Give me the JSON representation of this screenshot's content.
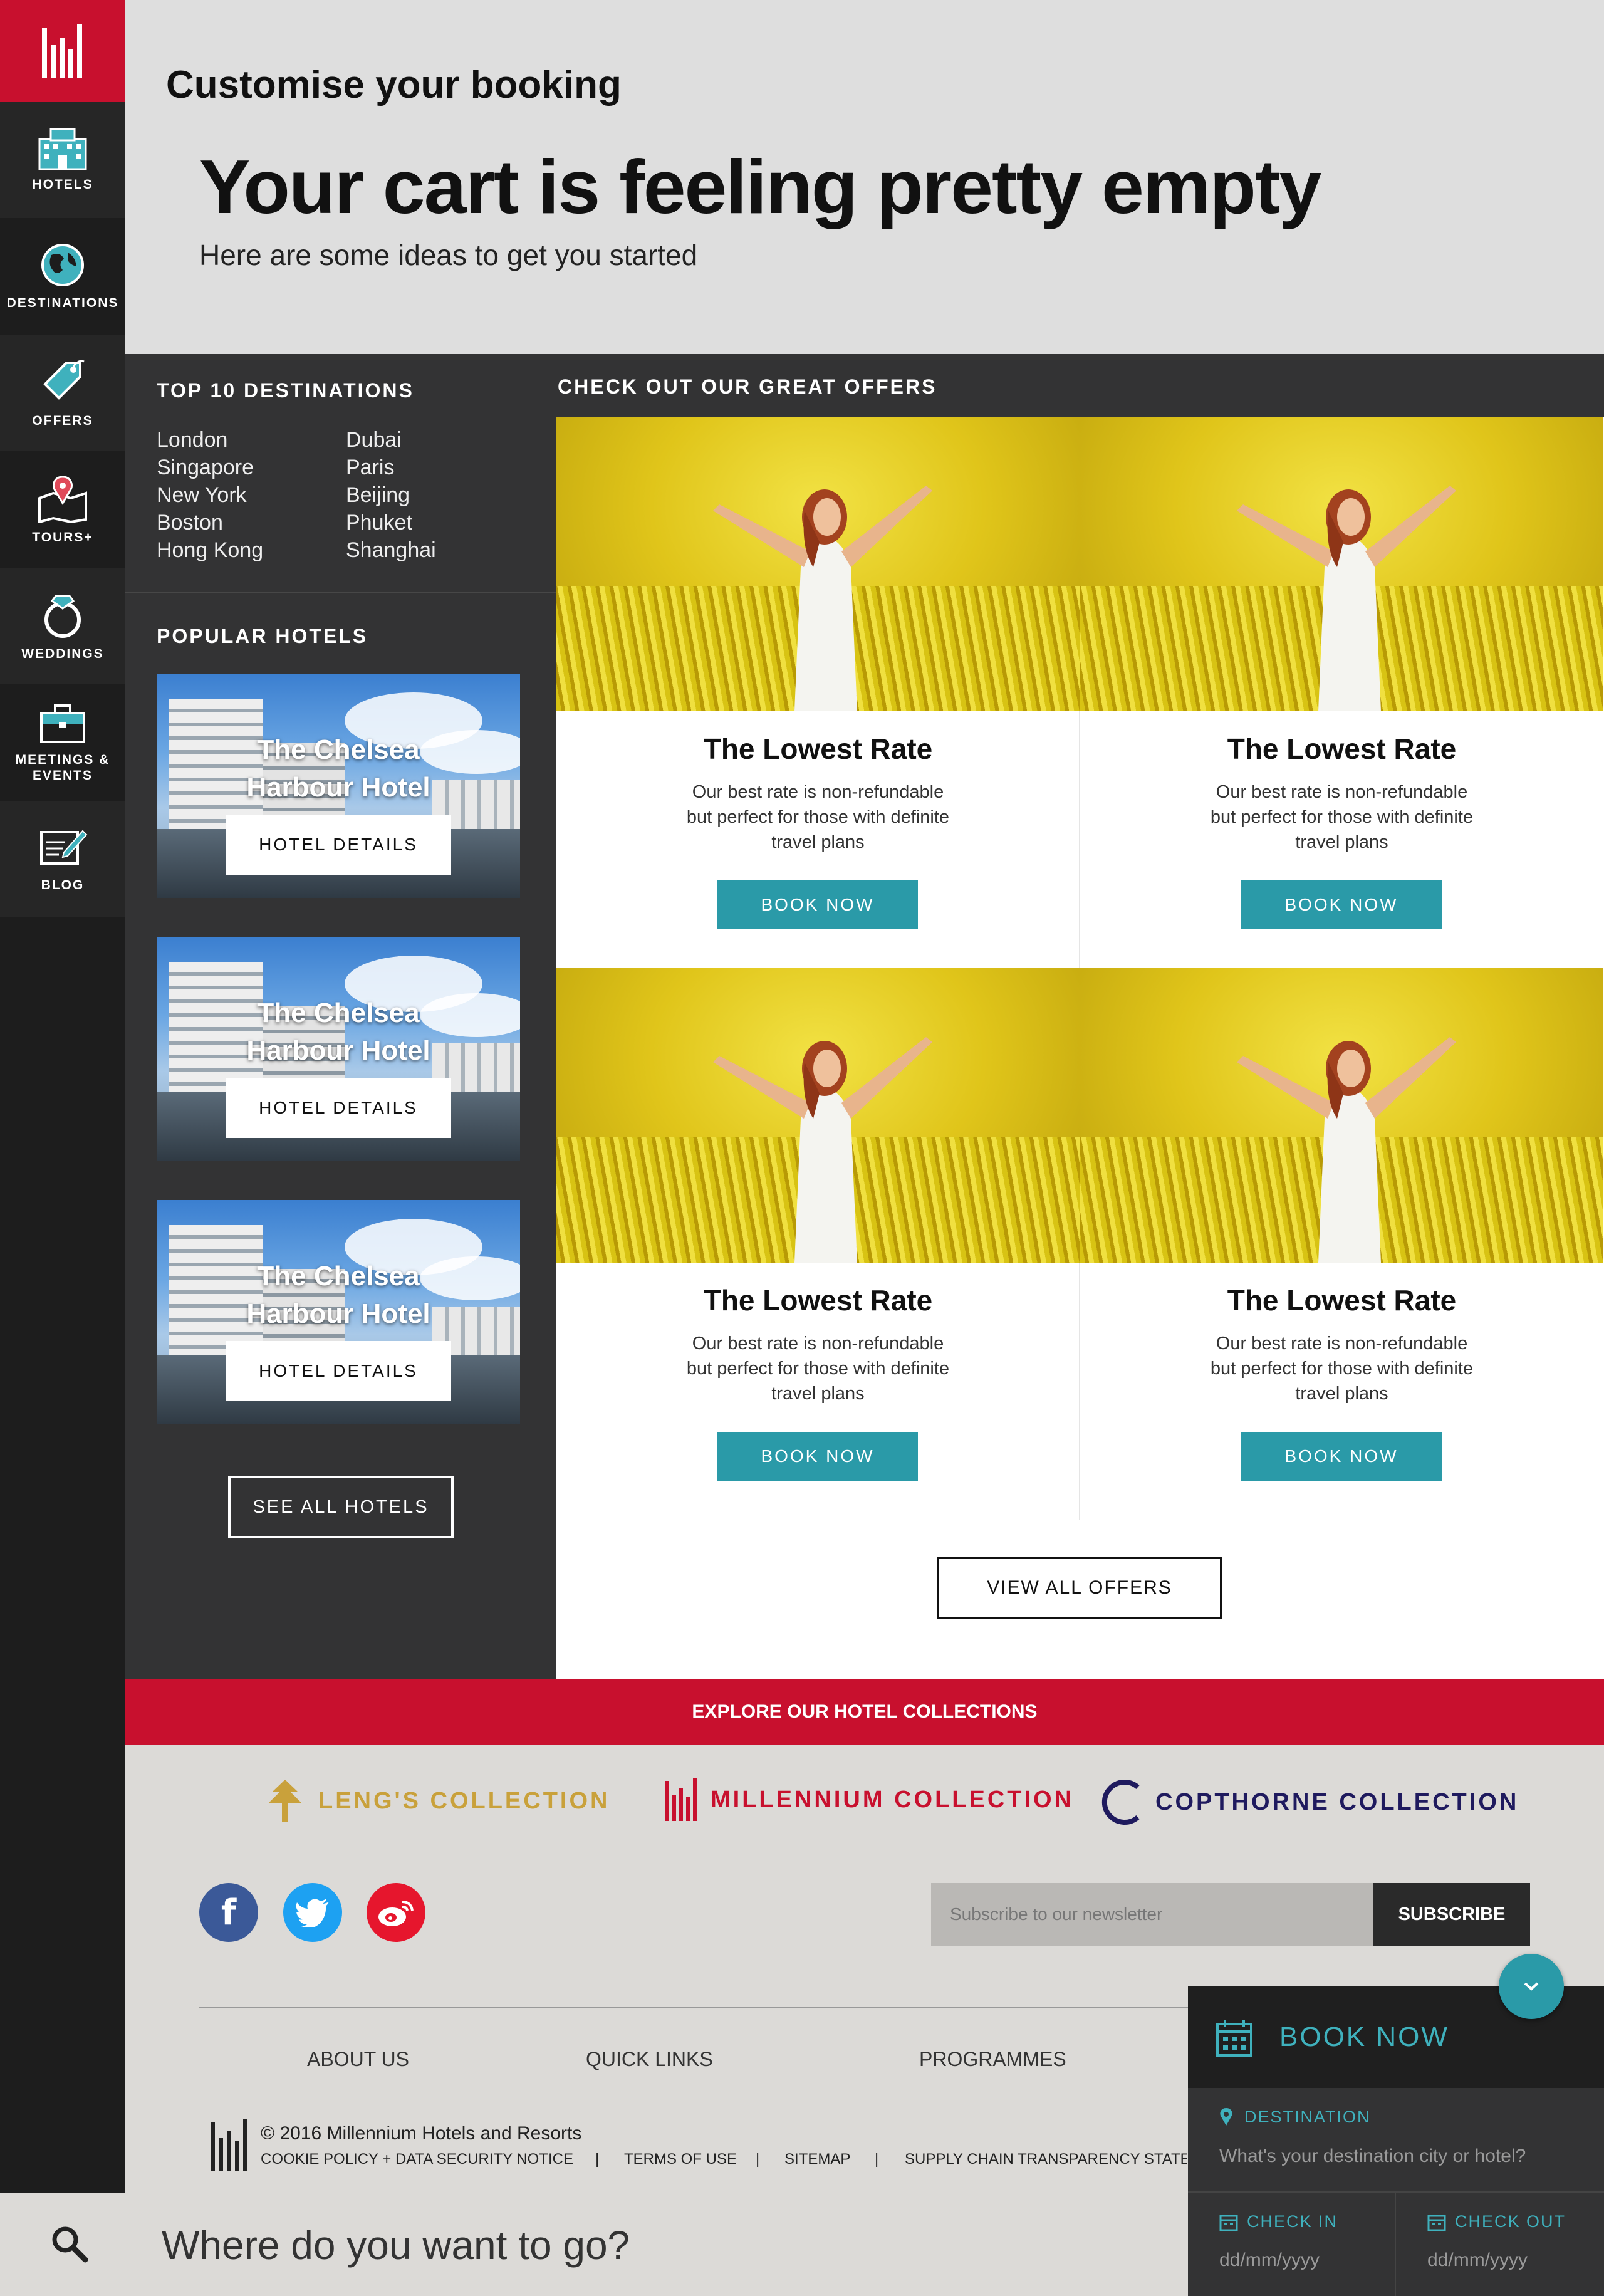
{
  "sidebar": {
    "items": [
      {
        "label": "HOTELS",
        "icon": "hotel-building-icon"
      },
      {
        "label": "DESTINATIONS",
        "icon": "globe-icon"
      },
      {
        "label": "OFFERS",
        "icon": "tag-icon"
      },
      {
        "label": "TOURS+",
        "icon": "map-pin-icon"
      },
      {
        "label": "WEDDINGS",
        "icon": "ring-icon"
      },
      {
        "label": "MEETINGS &",
        "label2": "EVENTS",
        "icon": "briefcase-icon"
      },
      {
        "label": "BLOG",
        "icon": "edit-note-icon"
      }
    ]
  },
  "header": {
    "kicker": "Customise your booking",
    "headline": "Your cart is feeling pretty empty",
    "subline": "Here are some ideas to get you started"
  },
  "destinations": {
    "title": "TOP 10 DESTINATIONS",
    "col1": [
      "London",
      "Singapore",
      "New York",
      "Boston",
      "Hong Kong"
    ],
    "col2": [
      "Dubai",
      "Paris",
      "Beijing",
      "Phuket",
      "Shanghai"
    ]
  },
  "popular_hotels": {
    "title": "POPULAR HOTELS",
    "cards": [
      {
        "name_line1": "The Chelsea",
        "name_line2": "Harbour Hotel",
        "button": "HOTEL DETAILS"
      },
      {
        "name_line1": "The Chelsea",
        "name_line2": "Harbour Hotel",
        "button": "HOTEL DETAILS"
      },
      {
        "name_line1": "The Chelsea",
        "name_line2": "Harbour Hotel",
        "button": "HOTEL DETAILS"
      }
    ],
    "see_all": "SEE ALL HOTELS"
  },
  "offers": {
    "title": "CHECK OUT OUR GREAT OFFERS",
    "cards": [
      {
        "title": "The Lowest Rate",
        "desc1": "Our best rate is non-refundable",
        "desc2": "but perfect for those with definite",
        "desc3": "travel plans",
        "button": "BOOK NOW"
      },
      {
        "title": "The Lowest Rate",
        "desc1": "Our best rate is non-refundable",
        "desc2": "but perfect for those with definite",
        "desc3": "travel plans",
        "button": "BOOK NOW"
      },
      {
        "title": "The Lowest Rate",
        "desc1": "Our best rate is non-refundable",
        "desc2": "but perfect for those with definite",
        "desc3": "travel plans",
        "button": "BOOK NOW"
      },
      {
        "title": "The Lowest Rate",
        "desc1": "Our best rate is non-refundable",
        "desc2": "but perfect for those with definite",
        "desc3": "travel plans",
        "button": "BOOK NOW"
      }
    ],
    "view_all": "VIEW ALL OFFERS"
  },
  "collections": {
    "banner": "EXPLORE OUR HOTEL COLLECTIONS",
    "items": [
      {
        "label": "LENG'S COLLECTION",
        "color": "#c9a13b"
      },
      {
        "label": "MILLENNIUM COLLECTION",
        "color": "#c8102e"
      },
      {
        "label": "COPTHORNE COLLECTION",
        "color": "#1f1a5e"
      }
    ]
  },
  "social": {
    "facebook": "#3b5998",
    "twitter": "#1da1f2",
    "weibo": "#e6162d"
  },
  "newsletter": {
    "placeholder": "Subscribe to our newsletter",
    "button": "SUBSCRIBE"
  },
  "footer": {
    "links": [
      "ABOUT US",
      "QUICK LINKS",
      "PROGRAMMES"
    ],
    "copyright": "© 2016 Millennium Hotels and Resorts",
    "legal": [
      "COOKIE POLICY + DATA SECURITY NOTICE",
      "|",
      "TERMS OF USE",
      "|",
      "SITEMAP",
      "|",
      "SUPPLY CHAIN TRANSPARENCY STATEM"
    ]
  },
  "search": {
    "placeholder": "Where do you want to go?"
  },
  "booknow": {
    "title": "BOOK NOW",
    "destination_label": "DESTINATION",
    "destination_placeholder": "What's your destination city or hotel?",
    "checkin_label": "CHECK IN",
    "checkin_placeholder": "dd/mm/yyyy",
    "checkout_label": "CHECK OUT",
    "checkout_placeholder": "dd/mm/yyyy"
  },
  "colors": {
    "brand_red": "#c8102e",
    "teal": "#2a9aa8",
    "dark": "#333334"
  }
}
